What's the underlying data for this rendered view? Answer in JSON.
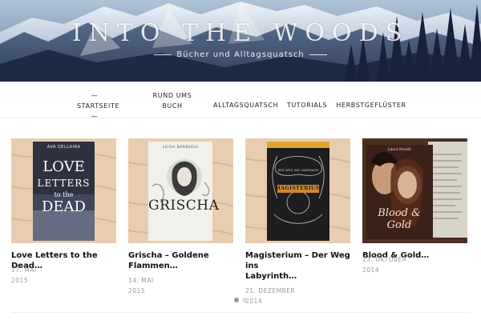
{
  "header": {
    "title": "INTO THE WOODS",
    "tagline": "Bücher und Alltagsquatsch"
  },
  "nav": {
    "items": [
      {
        "line1": "— STARTSEITE",
        "line2": "—",
        "active": true
      },
      {
        "line1": "RUND UMS",
        "line2": "BUCH",
        "active": false
      },
      {
        "line1": "ALLTAGSQUATSCH",
        "line2": "",
        "active": false
      },
      {
        "line1": "TUTORIALS",
        "line2": "",
        "active": false
      },
      {
        "line1": "HERBSTGEFLÜSTER",
        "line2": "",
        "active": false
      }
    ]
  },
  "posts": [
    {
      "title_line1": "Love Letters to the Dead…",
      "title_line2": "",
      "date_line1": "17. MAI",
      "date_line2": "2015",
      "cover": {
        "author": "AVA DELLAIRA",
        "words": [
          "LOVE",
          "LETTERS",
          "to the",
          "DEAD"
        ],
        "bg": "#2b2f36",
        "text_color": "#ffffff"
      }
    },
    {
      "title_line1": "Grischa – Goldene",
      "title_line2": "Flammen…",
      "date_line1": "14. MAI",
      "date_line2": "2015",
      "cover": {
        "author": "LEIGH BARDUGO",
        "words": [
          "GRISCHA"
        ],
        "bg": "#eeeeea",
        "text_color": "#222222"
      }
    },
    {
      "title_line1": "Magisterium – Der Weg ins",
      "title_line2": "Labyrinth…",
      "date_line1": "21. DEZEMBER",
      "date_line2": "2014",
      "cover": {
        "author": "",
        "words": [
          "MAGISTERIUM",
          "DER WEG INS LABYRINTH"
        ],
        "bg": "#1c1c1e",
        "text_color": "#d2a23c"
      }
    },
    {
      "title_line1": "Blood & Gold…",
      "title_line2": "",
      "date_line1": "23. OKTOBER",
      "date_line2": "2014",
      "cover": {
        "author": "Laura Kneidl",
        "words": [
          "Blood &",
          "Gold"
        ],
        "bg": "#3d2418",
        "text_color": "#e9d7bf"
      }
    }
  ],
  "carousel": {
    "dots": 2,
    "active_dot": 0,
    "dot_active_color": "#999999",
    "dot_color": "#dddddd"
  },
  "colors": {
    "accent": "#222222",
    "wood_background": "#e9cfb4"
  }
}
